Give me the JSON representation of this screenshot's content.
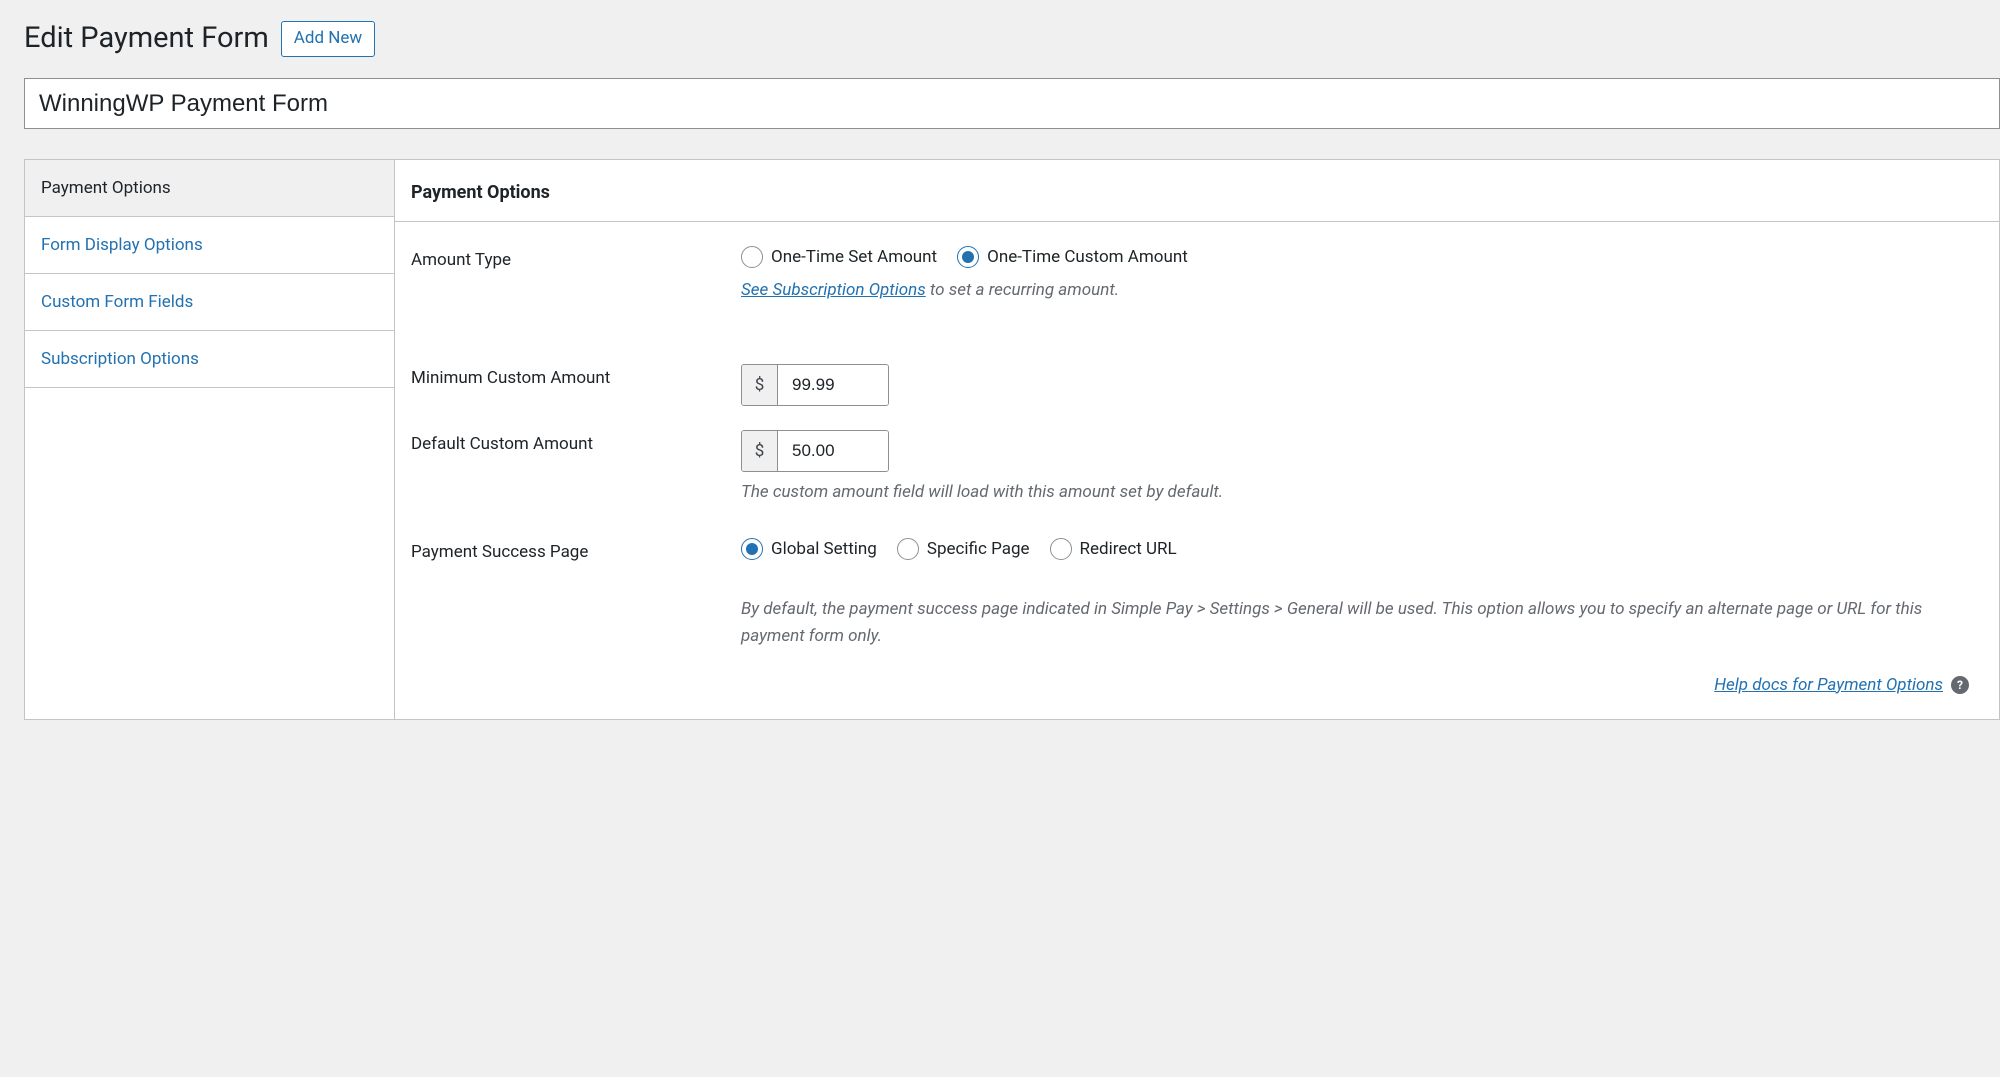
{
  "header": {
    "page_title": "Edit Payment Form",
    "add_new_label": "Add New"
  },
  "title_input": {
    "value": "WinningWP Payment Form"
  },
  "tabs": [
    {
      "label": "Payment Options",
      "active": true
    },
    {
      "label": "Form Display Options",
      "active": false
    },
    {
      "label": "Custom Form Fields",
      "active": false
    },
    {
      "label": "Subscription Options",
      "active": false
    }
  ],
  "panel": {
    "heading": "Payment Options",
    "amount_type": {
      "label": "Amount Type",
      "options": [
        {
          "label": "One-Time Set Amount",
          "checked": false
        },
        {
          "label": "One-Time Custom Amount",
          "checked": true
        }
      ],
      "sub_link_text": "See Subscription Options",
      "sub_rest_text": " to set a recurring amount."
    },
    "min_custom": {
      "label": "Minimum Custom Amount",
      "currency_symbol": "$",
      "value": "99.99"
    },
    "default_custom": {
      "label": "Default Custom Amount",
      "currency_symbol": "$",
      "value": "50.00",
      "description": "The custom amount field will load with this amount set by default."
    },
    "success_page": {
      "label": "Payment Success Page",
      "options": [
        {
          "label": "Global Setting",
          "checked": true
        },
        {
          "label": "Specific Page",
          "checked": false
        },
        {
          "label": "Redirect URL",
          "checked": false
        }
      ],
      "description": "By default, the payment success page indicated in Simple Pay > Settings > General will be used. This option allows you to specify an alternate page or URL for this payment form only."
    },
    "footer": {
      "help_link": "Help docs for Payment Options",
      "help_icon_text": "?"
    }
  }
}
